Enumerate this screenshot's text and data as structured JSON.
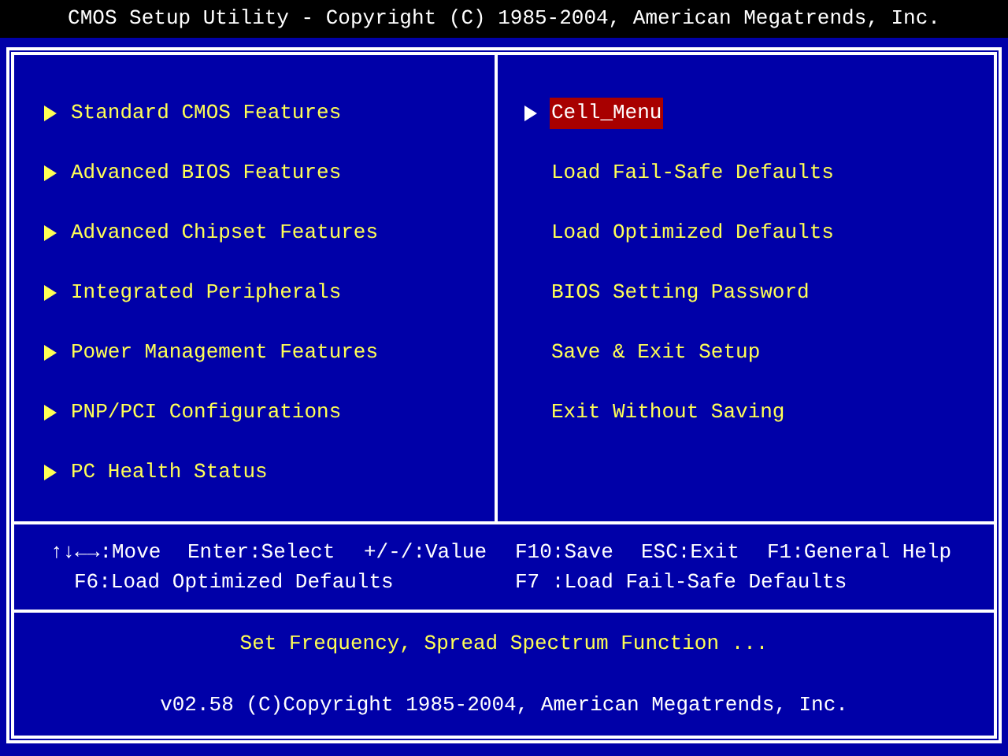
{
  "window": {
    "title": "CMOS Setup Utility - Copyright (C) 1985-2004, American Megatrends, Inc."
  },
  "menu_left": [
    {
      "label": "Standard CMOS Features",
      "submenu": true,
      "selected": false
    },
    {
      "label": "Advanced BIOS Features",
      "submenu": true,
      "selected": false
    },
    {
      "label": "Advanced Chipset Features",
      "submenu": true,
      "selected": false
    },
    {
      "label": "Integrated Peripherals",
      "submenu": true,
      "selected": false
    },
    {
      "label": "Power Management Features",
      "submenu": true,
      "selected": false
    },
    {
      "label": "PNP/PCI Configurations",
      "submenu": true,
      "selected": false
    },
    {
      "label": "PC Health Status",
      "submenu": true,
      "selected": false
    }
  ],
  "menu_right": [
    {
      "label": "Cell_Menu",
      "submenu": true,
      "selected": true
    },
    {
      "label": "Load Fail-Safe Defaults",
      "submenu": false,
      "selected": false
    },
    {
      "label": "Load Optimized Defaults",
      "submenu": false,
      "selected": false
    },
    {
      "label": "BIOS Setting Password",
      "submenu": false,
      "selected": false
    },
    {
      "label": "Save & Exit Setup",
      "submenu": false,
      "selected": false
    },
    {
      "label": "Exit Without Saving",
      "submenu": false,
      "selected": false
    }
  ],
  "key_help": [
    [
      "↑↓←→:Move",
      "Enter:Select",
      "+/-/:Value",
      "F10:Save",
      "ESC:Exit",
      "F1:General Help"
    ],
    [
      "F6:Load Optimized Defaults",
      "F7 :Load Fail-Safe Defaults"
    ]
  ],
  "status": "Set Frequency, Spread Spectrum Function ...",
  "footer": "v02.58 (C)Copyright 1985-2004, American Megatrends, Inc."
}
